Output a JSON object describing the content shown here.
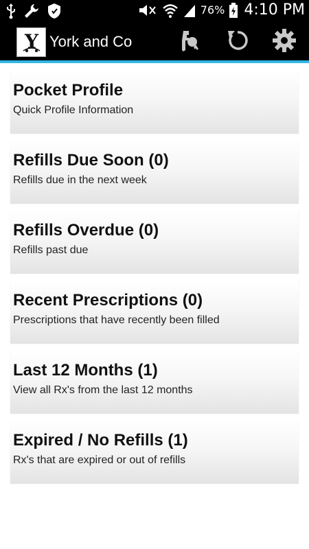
{
  "status_bar": {
    "battery_percent": "76%",
    "time": "4:10 PM",
    "icons": [
      "usb-icon",
      "wrench-icon",
      "shield-icon",
      "mute-icon",
      "wifi-icon",
      "signal-icon",
      "battery-icon"
    ]
  },
  "app_bar": {
    "title": "York and Co",
    "logo_letter": "Y",
    "actions": [
      "key-icon",
      "refresh-icon",
      "settings-icon"
    ],
    "accent_color": "#33b5e5"
  },
  "menu": {
    "items": [
      {
        "title": "Pocket Profile",
        "subtitle": "Quick Profile Information"
      },
      {
        "title": "Refills Due Soon (0)",
        "subtitle": "Refills due in the next week"
      },
      {
        "title": "Refills Overdue (0)",
        "subtitle": "Refills past due"
      },
      {
        "title": "Recent Prescriptions (0)",
        "subtitle": "Prescriptions that have recently been filled"
      },
      {
        "title": "Last 12 Months (1)",
        "subtitle": "View all Rx's from the last 12 months"
      },
      {
        "title": "Expired / No Refills (1)",
        "subtitle": "Rx's that are expired or out of refills"
      }
    ]
  }
}
